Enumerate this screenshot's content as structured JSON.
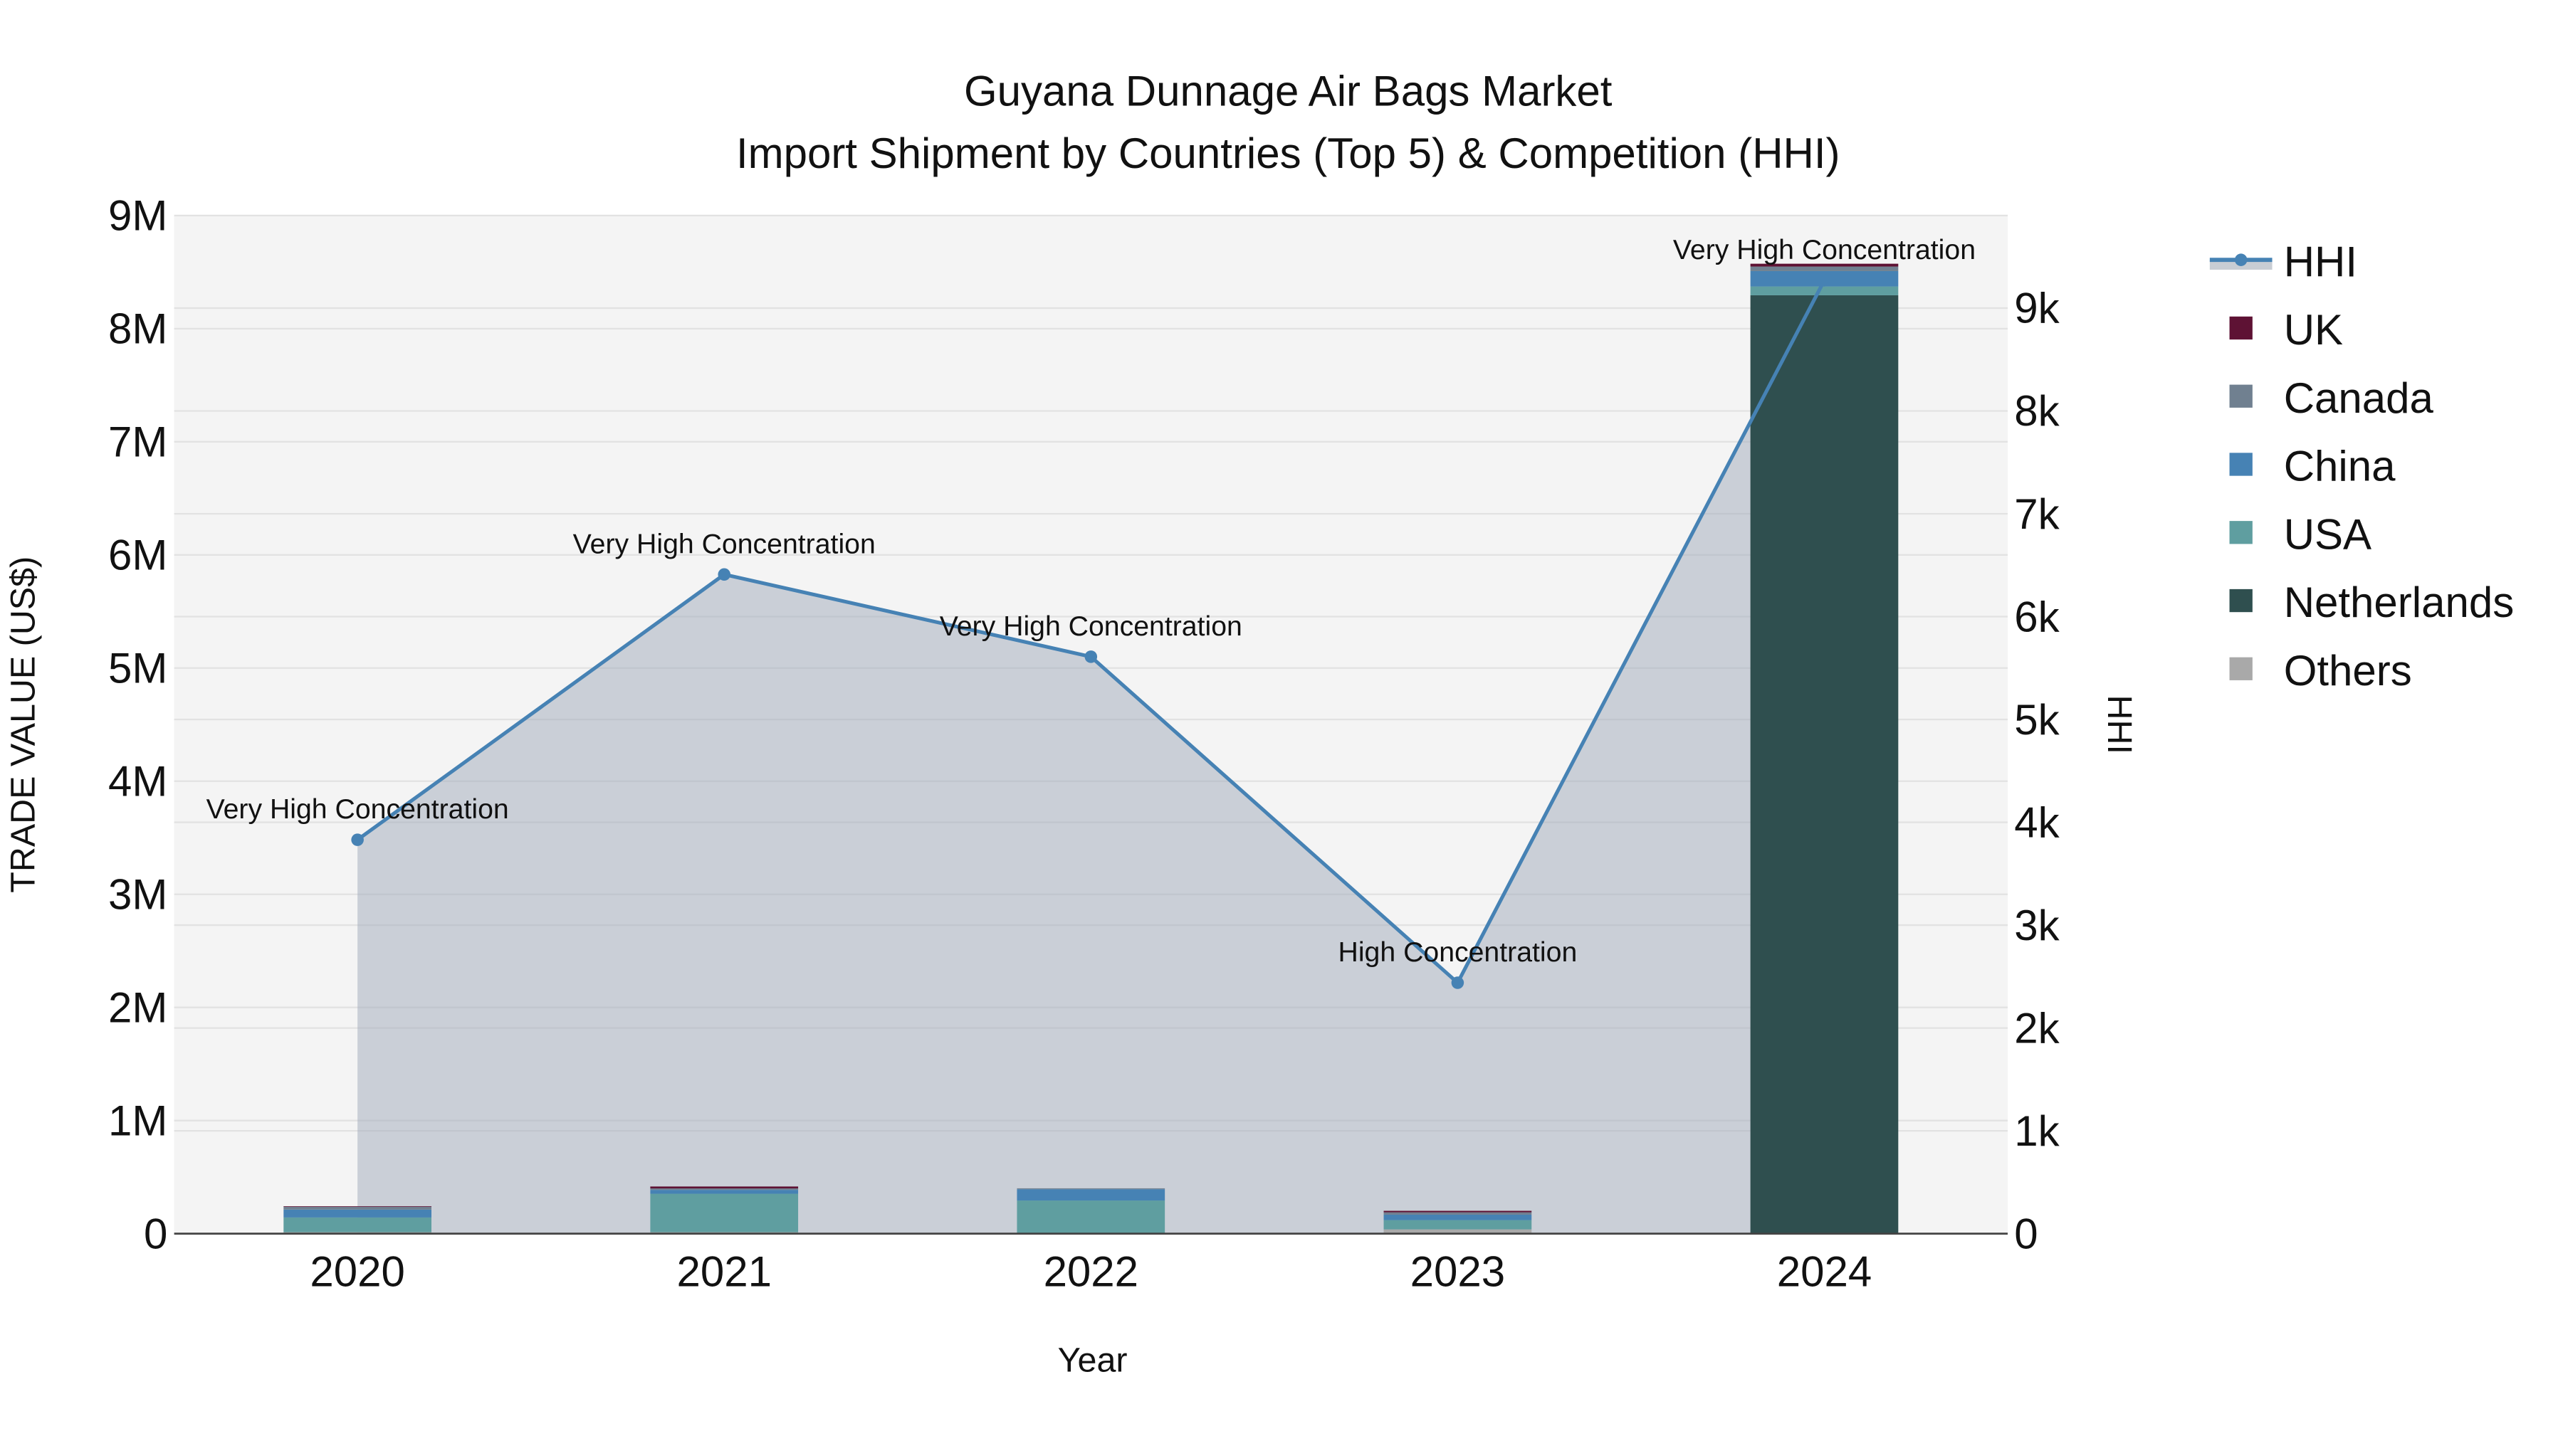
{
  "chart_data": {
    "type": "bar",
    "title_line1": "Guyana Dunnage Air Bags Market",
    "title_line2": "Import Shipment by Countries (Top 5) & Competition (HHI)",
    "xlabel": "Year",
    "ylabel": "TRADE VALUE (US$)",
    "y2label": "HHI",
    "categories": [
      "2020",
      "2021",
      "2022",
      "2023",
      "2024"
    ],
    "ylim": [
      0,
      9000000
    ],
    "y2lim": [
      0,
      9900
    ],
    "yticks": [
      {
        "v": 0,
        "label": "0"
      },
      {
        "v": 1000000,
        "label": "1M"
      },
      {
        "v": 2000000,
        "label": "2M"
      },
      {
        "v": 3000000,
        "label": "3M"
      },
      {
        "v": 4000000,
        "label": "4M"
      },
      {
        "v": 5000000,
        "label": "5M"
      },
      {
        "v": 6000000,
        "label": "6M"
      },
      {
        "v": 7000000,
        "label": "7M"
      },
      {
        "v": 8000000,
        "label": "8M"
      },
      {
        "v": 9000000,
        "label": "9M"
      }
    ],
    "y2ticks": [
      {
        "v": 0,
        "label": "0"
      },
      {
        "v": 1000,
        "label": "1k"
      },
      {
        "v": 2000,
        "label": "2k"
      },
      {
        "v": 3000,
        "label": "3k"
      },
      {
        "v": 4000,
        "label": "4k"
      },
      {
        "v": 5000,
        "label": "5k"
      },
      {
        "v": 6000,
        "label": "6k"
      },
      {
        "v": 7000,
        "label": "7k"
      },
      {
        "v": 8000,
        "label": "8k"
      },
      {
        "v": 9000,
        "label": "9k"
      }
    ],
    "series": [
      {
        "name": "Others",
        "color": "#a9a9a9",
        "values": [
          13000,
          13000,
          3000,
          38000,
          5000
        ]
      },
      {
        "name": "Netherlands",
        "color": "#2f4f4f",
        "values": [
          0,
          0,
          0,
          0,
          8290000
        ]
      },
      {
        "name": "USA",
        "color": "#5f9ea0",
        "values": [
          130000,
          340000,
          290000,
          82000,
          78000
        ]
      },
      {
        "name": "China",
        "color": "#4682b4",
        "values": [
          70000,
          34000,
          100000,
          48000,
          136000
        ]
      },
      {
        "name": "Canada",
        "color": "#708090",
        "values": [
          25000,
          13000,
          8000,
          21000,
          40000
        ]
      },
      {
        "name": "UK",
        "color": "#5e1234",
        "values": [
          5000,
          17000,
          0,
          13000,
          25000
        ]
      }
    ],
    "hhi": {
      "name": "HHI",
      "color": "#4682b4",
      "values": [
        3830,
        6410,
        5610,
        2440,
        9270
      ],
      "annotations": [
        "Very High Concentration",
        "Very High Concentration",
        "Very High Concentration",
        "High Concentration",
        "Very High Concentration"
      ]
    },
    "legend": {
      "placement": "right",
      "order": [
        "HHI",
        "UK",
        "Canada",
        "China",
        "USA",
        "Netherlands",
        "Others"
      ]
    },
    "grid": true
  }
}
